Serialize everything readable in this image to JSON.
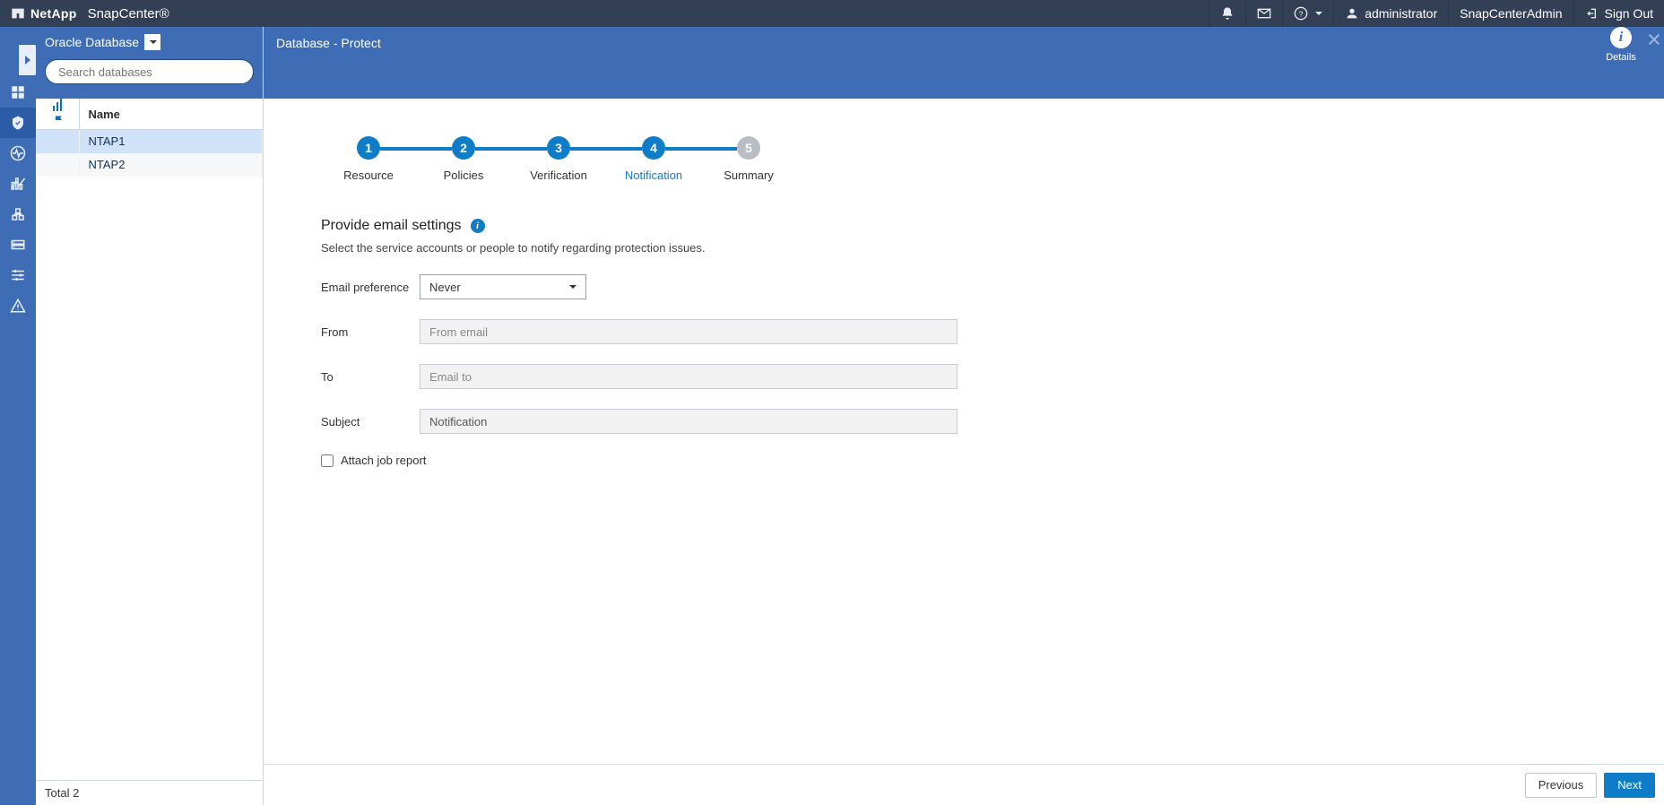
{
  "topbar": {
    "brand_company": "NetApp",
    "brand_product": "SnapCenter®",
    "user_name": "administrator",
    "role": "SnapCenterAdmin",
    "sign_out": "Sign Out"
  },
  "sidebar": {
    "resource_type": "Oracle Database",
    "search_placeholder": "Search databases",
    "col_name": "Name",
    "rows": [
      {
        "name": "NTAP1",
        "selected": true
      },
      {
        "name": "NTAP2",
        "selected": false
      }
    ],
    "total_label": "Total 2"
  },
  "main": {
    "title": "Database - Protect",
    "details_label": "Details",
    "stepper": [
      {
        "num": "1",
        "label": "Resource",
        "state": "done"
      },
      {
        "num": "2",
        "label": "Policies",
        "state": "done"
      },
      {
        "num": "3",
        "label": "Verification",
        "state": "done"
      },
      {
        "num": "4",
        "label": "Notification",
        "state": "current"
      },
      {
        "num": "5",
        "label": "Summary",
        "state": "inactive"
      }
    ],
    "form": {
      "heading": "Provide email settings",
      "subtext": "Select the service accounts or people to notify regarding protection issues.",
      "email_pref_label": "Email preference",
      "email_pref_value": "Never",
      "from_label": "From",
      "from_placeholder": "From email",
      "to_label": "To",
      "to_placeholder": "Email to",
      "subject_label": "Subject",
      "subject_value": "Notification",
      "attach_label": "Attach job report"
    },
    "buttons": {
      "prev": "Previous",
      "next": "Next"
    }
  }
}
